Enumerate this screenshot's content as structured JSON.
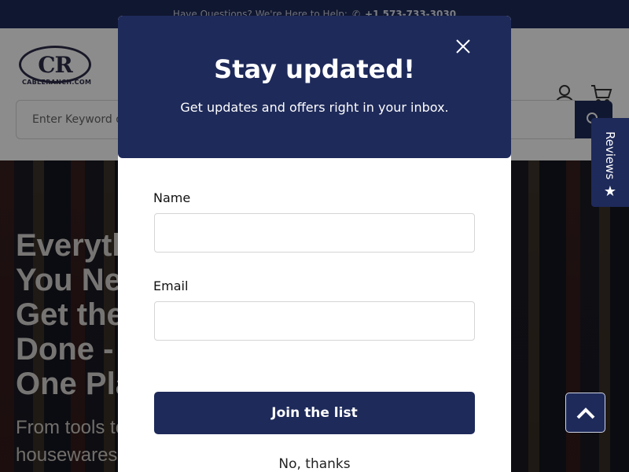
{
  "topbar": {
    "question": "Have Questions? We're Here to Help:",
    "phone": "+1 573-733-3030"
  },
  "header": {
    "logo_text": "CR",
    "logo_sub": "CABLERANCH.COM",
    "search_placeholder": "Enter Keyword or"
  },
  "hero": {
    "title": "Everything You Need to Get the Job Done - All in One Place",
    "subtitle": "From tools to housewares"
  },
  "modal": {
    "title": "Stay updated!",
    "text": "Get updates and offers right in your inbox.",
    "name_label": "Name",
    "email_label": "Email",
    "join_label": "Join the list",
    "no_thanks_label": "No, thanks"
  },
  "reviews_tab": {
    "label": "Reviews"
  },
  "colors": {
    "brand_navy": "#1e2a5a"
  }
}
